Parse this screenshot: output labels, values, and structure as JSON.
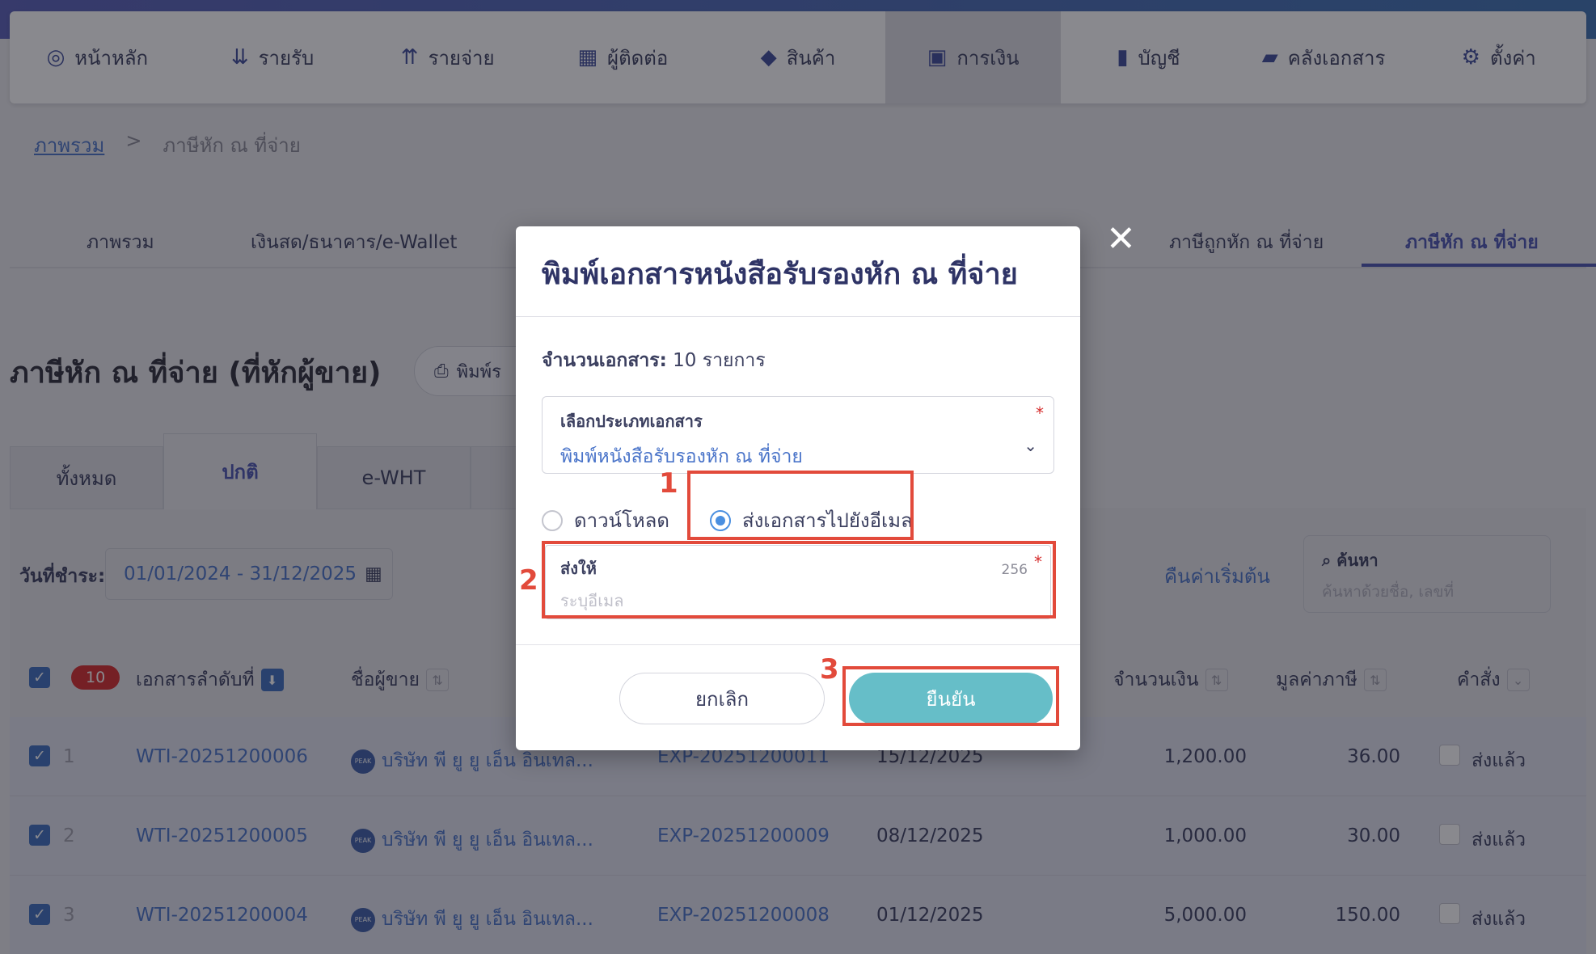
{
  "nav": {
    "items": [
      {
        "label": "หน้าหลัก",
        "icon": "◎"
      },
      {
        "label": "รายรับ",
        "icon": "⇊"
      },
      {
        "label": "รายจ่าย",
        "icon": "⇈"
      },
      {
        "label": "ผู้ติดต่อ",
        "icon": "▦"
      },
      {
        "label": "สินค้า",
        "icon": "◆"
      },
      {
        "label": "การเงิน",
        "icon": "▣"
      },
      {
        "label": "บัญชี",
        "icon": "▮"
      },
      {
        "label": "คลังเอกสาร",
        "icon": "▰"
      },
      {
        "label": "ตั้งค่า",
        "icon": "⚙"
      }
    ],
    "active_index": 5
  },
  "breadcrumb": {
    "root": "ภาพรวม",
    "separator": ">",
    "current": "ภาษีหัก ณ ที่จ่าย"
  },
  "main_tabs": [
    "ภาพรวม",
    "เงินสด/ธนาคาร/e-Wallet",
    "ภาษีถูกหัก ณ ที่จ่าย",
    "ภาษีหัก ณ ที่จ่าย"
  ],
  "page": {
    "title": "ภาษีหัก ณ ที่จ่าย (ที่หักผู้ขาย)",
    "print_label": "พิมพ์ร"
  },
  "sub_tabs": [
    "ทั้งหมด",
    "ปกติ",
    "e-WHT"
  ],
  "filters": {
    "date_label": "วันที่ชำระ:",
    "date_range": "01/01/2024 - 31/12/2025",
    "reset_label": "คืนค่าเริ่มต้น",
    "search_title": "ค้นหา",
    "search_placeholder": "ค้นหาด้วยชื่อ, เลขที่"
  },
  "table": {
    "selected_count": "10",
    "headers": {
      "doc_no": "เอกสารลำดับที่",
      "vendor": "ชื่อผู้ขาย",
      "amount": "จำนวนเงิน",
      "tax": "มูลค่าภาษี",
      "action": "คำสั่ง"
    },
    "rows": [
      {
        "index": "1",
        "doc_no": "WTI-20251200006",
        "vendor": "บริษัท พี ยู ยู เอ็น อินเทล...",
        "ref": "EXP-20251200011",
        "date": "15/12/2025",
        "amount": "1,200.00",
        "tax": "36.00",
        "status": "ส่งแล้ว"
      },
      {
        "index": "2",
        "doc_no": "WTI-20251200005",
        "vendor": "บริษัท พี ยู ยู เอ็น อินเทล...",
        "ref": "EXP-20251200009",
        "date": "08/12/2025",
        "amount": "1,000.00",
        "tax": "30.00",
        "status": "ส่งแล้ว"
      },
      {
        "index": "3",
        "doc_no": "WTI-20251200004",
        "vendor": "บริษัท พี ยู ยู เอ็น อินเทล...",
        "ref": "EXP-20251200008",
        "date": "01/12/2025",
        "amount": "5,000.00",
        "tax": "150.00",
        "status": "ส่งแล้ว"
      }
    ]
  },
  "modal": {
    "title": "พิมพ์เอกสารหนังสือรับรองหัก ณ ที่จ่าย",
    "doc_count_label": "จำนวนเอกสาร:",
    "doc_count_value": "10 รายการ",
    "doc_type_label": "เลือกประเภทเอกสาร",
    "doc_type_value": "พิมพ์หนังสือรับรองหัก ณ ที่จ่าย",
    "option_download": "ดาวน์โหลด",
    "option_email": "ส่งเอกสารไปยังอีเมล",
    "selected_option": "email",
    "email_label": "ส่งให้",
    "email_limit": "256",
    "email_placeholder": "ระบุอีเมล",
    "email_value": "",
    "cancel_label": "ยกเลิก",
    "confirm_label": "ยืนยัน"
  },
  "annotations": [
    "1",
    "2",
    "3"
  ],
  "colors": {
    "accent": "#4a54b0",
    "link": "#4a74c9",
    "confirm": "#66bec8",
    "annotation": "#e24a3b",
    "badge": "#d62d2d"
  }
}
